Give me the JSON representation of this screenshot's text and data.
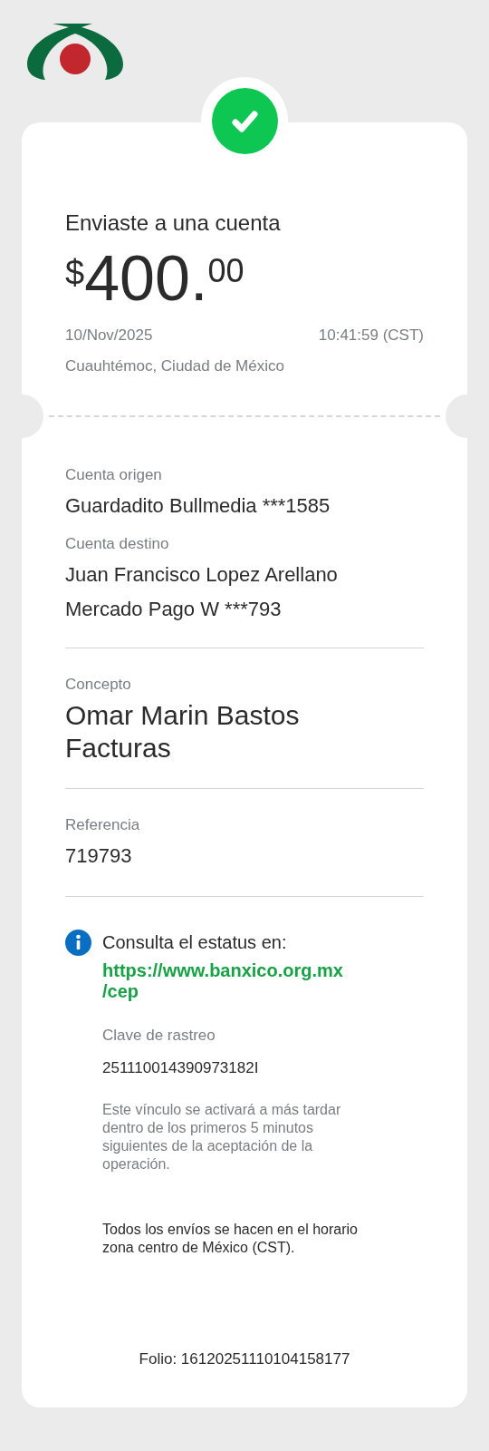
{
  "header": {
    "title": "Enviaste a una cuenta",
    "amount": {
      "currency": "$",
      "integer": "400.",
      "decimals": "00"
    },
    "date": "10/Nov/2025",
    "time": "10:41:59 (CST)",
    "location": "Cuauhtémoc, Ciudad de México"
  },
  "details": [
    {
      "label": "Cuenta origen",
      "lines": [
        "Guardadito Bullmedia ***1585"
      ],
      "kind": "normal"
    },
    {
      "label": "Cuenta destino",
      "lines": [
        "Juan Francisco Lopez Arellano",
        "Mercado Pago W ***793"
      ],
      "kind": "normal"
    },
    {
      "label": "Concepto",
      "lines": [
        "Omar Marin Bastos Facturas"
      ],
      "kind": "large"
    },
    {
      "label": "Referencia",
      "lines": [
        "719793"
      ],
      "kind": "normal"
    }
  ],
  "status": {
    "text": "Consulta el estatus en:",
    "link_lines": [
      "https://www.banxico.org.mx",
      "/cep"
    ],
    "tracking_label": "Clave de rastreo",
    "tracking_key": "251110014390973182I",
    "note": "Este vínculo se activará a más tardar dentro de los primeros 5 minutos siguientes de la aceptación de la operación."
  },
  "timezone_note": "Todos los envíos se hacen en el horario zona centro de México (CST).",
  "folio": "Folio: 16120251110104158177"
}
